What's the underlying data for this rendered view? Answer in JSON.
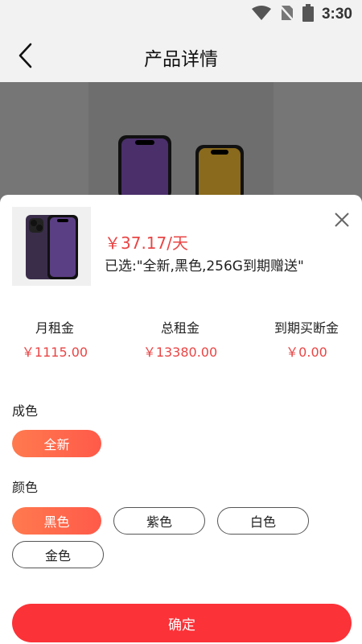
{
  "status_bar": {
    "time": "3:30"
  },
  "nav": {
    "title": "产品详情"
  },
  "product": {
    "price": "￥37.17/天",
    "selected": "已选:\"全新,黑色,256G到期赠送\""
  },
  "stats": [
    {
      "label": "月租金",
      "value": "￥1115.00"
    },
    {
      "label": "总租金",
      "value": "￥13380.00"
    },
    {
      "label": "到期买断金",
      "value": "￥0.00"
    }
  ],
  "condition": {
    "title": "成色",
    "options": [
      "全新"
    ],
    "selected": "全新"
  },
  "color": {
    "title": "颜色",
    "options": [
      "黑色",
      "紫色",
      "白色",
      "金色"
    ],
    "selected": "黑色"
  },
  "confirm_label": "确定"
}
